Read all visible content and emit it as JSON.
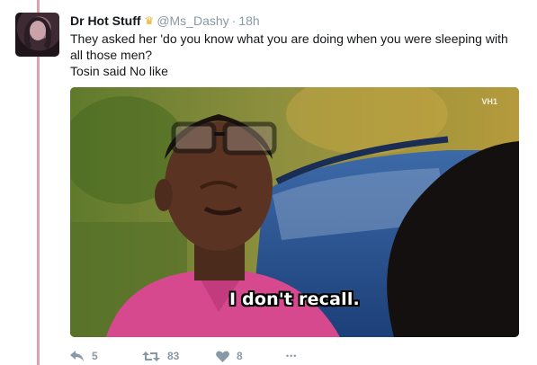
{
  "tweet": {
    "author_name": "Dr Hot Stuff",
    "author_badge": "crown-icon",
    "handle": "@Ms_Dashy",
    "separator": "·",
    "time": "18h",
    "text_lines": [
      "They asked her 'do you know what you are doing when you were sleeping with",
      "all those men?",
      "Tosin said No like"
    ]
  },
  "media": {
    "subtitle": "I don't recall.",
    "watermark": "VH1"
  },
  "actions": {
    "reply": {
      "icon": "reply-icon",
      "count": "5"
    },
    "retweet": {
      "icon": "retweet-icon",
      "count": "83"
    },
    "like": {
      "icon": "heart-icon",
      "count": "8"
    },
    "more": {
      "icon": "more-icon",
      "label": "•••"
    }
  },
  "colors": {
    "thread_line": "#e0a0ae",
    "text": "#14171a",
    "muted": "#8899a6",
    "crown": "#e8b12a"
  }
}
